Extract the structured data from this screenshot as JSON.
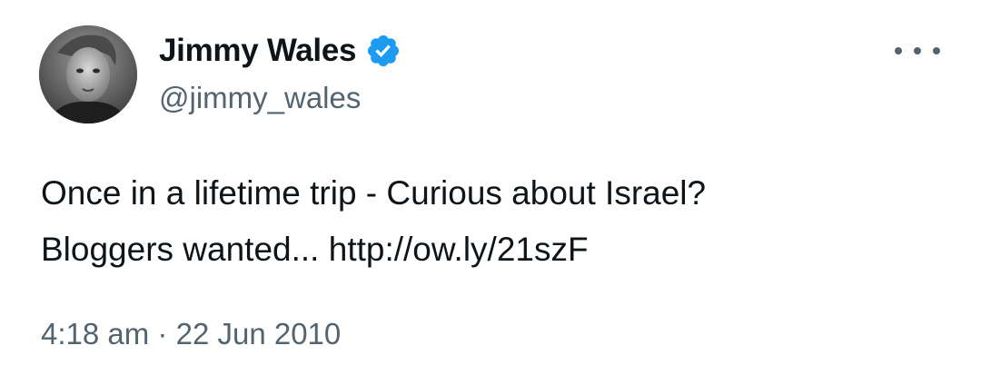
{
  "author": {
    "display_name": "Jimmy Wales",
    "handle": "@jimmy_wales",
    "verified": true,
    "verified_icon": "verified-badge-icon",
    "avatar_icon": "profile-photo"
  },
  "tweet": {
    "text_line1": "Once in a lifetime trip - Curious about Israel?",
    "text_line2_prefix": "Bloggers wanted... ",
    "link_text": "http://ow.ly/21szF"
  },
  "meta": {
    "time": "4:18 am",
    "separator": "·",
    "date": "22 Jun 2010"
  },
  "menu": {
    "icon": "more-options-icon"
  },
  "colors": {
    "text": "#0f1419",
    "secondary": "#536471",
    "verified": "#1d9bf0",
    "background": "#ffffff"
  }
}
